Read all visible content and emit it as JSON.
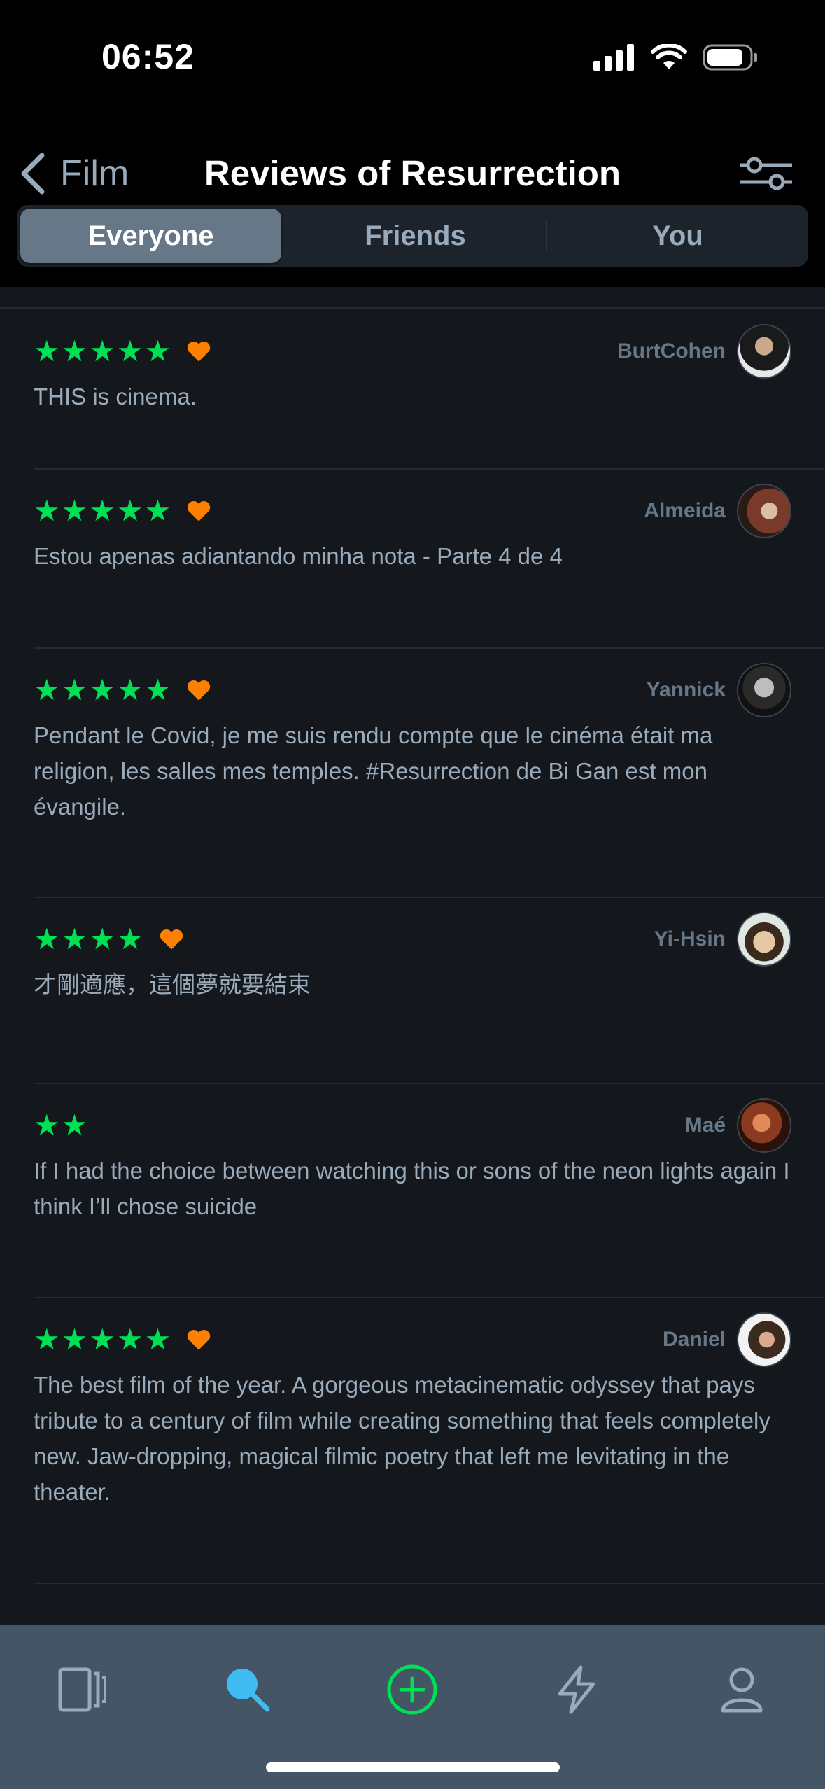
{
  "status_bar": {
    "time": "06:52"
  },
  "nav": {
    "back_label": "Film",
    "title": "Reviews of Resurrection"
  },
  "segments": [
    "Everyone",
    "Friends",
    "You"
  ],
  "reviews": [
    {
      "username": "BurtCohen",
      "rating": 5,
      "liked": true,
      "text": "THIS is cinema."
    },
    {
      "username": "Almeida",
      "rating": 5,
      "liked": true,
      "text": "Estou apenas adiantando minha nota - Parte 4 de 4"
    },
    {
      "username": "Yannick",
      "rating": 5,
      "liked": true,
      "text": "Pendant le Covid, je me suis rendu compte que le cinéma était ma religion, les salles mes temples. #Resurrection de Bi Gan est mon évangile."
    },
    {
      "username": "Yi-Hsin",
      "rating": 4,
      "liked": true,
      "text": "才剛適應，這個夢就要結束"
    },
    {
      "username": "Maé",
      "rating": 2,
      "liked": false,
      "text": "If I had the choice between watching this or sons of the neon lights again I think I’ll chose suicide"
    },
    {
      "username": "Daniel",
      "rating": 5,
      "liked": true,
      "text": "The best film of the year. A gorgeous metacinematic odyssey that pays tribute to a century of film while creating something that feels completely new. Jaw-dropping, magical filmic poetry that left me levitating in the theater."
    }
  ],
  "colors": {
    "background": "#14181c",
    "star": "#00e054",
    "heart": "#ff8000",
    "tabbar": "#445566",
    "active_tab": "#40bcf4"
  },
  "tabs": [
    {
      "icon": "films-icon"
    },
    {
      "icon": "search-icon",
      "active": true
    },
    {
      "icon": "add-icon"
    },
    {
      "icon": "activity-icon"
    },
    {
      "icon": "profile-icon"
    }
  ]
}
